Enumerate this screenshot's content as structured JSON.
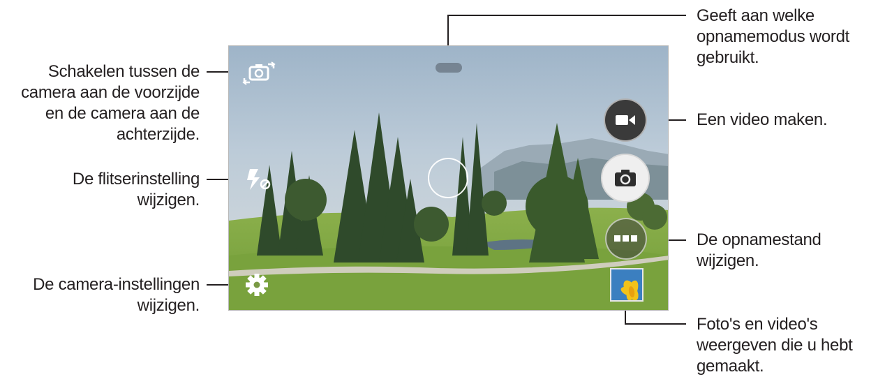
{
  "callouts": {
    "switch_camera": "Schakelen tussen de\ncamera aan de voorzijde\nen de camera aan de\nachterzijde.",
    "flash": "De flitserinstelling\nwijzigen.",
    "settings": "De camera-instellingen\nwijzigen.",
    "mode_indicator": "Geeft aan welke\nopnamemodus wordt\ngebruikt.",
    "record_video": "Een video maken.",
    "shooting_mode": "De opnamestand\nwijzigen.",
    "gallery": "Foto's en video's\nweergeven die u hebt\ngemaakt."
  },
  "icons": {
    "switch_camera": "switch-camera-icon",
    "flash": "flash-off-icon",
    "settings": "gear-icon",
    "video": "video-camera-icon",
    "shutter": "camera-icon",
    "mode": "more-dots-icon",
    "gallery": "gallery-thumbnail"
  },
  "colors": {
    "text": "#231f20",
    "leader": "#231f20",
    "sky": "#a9bdd0",
    "grass": "#7fa543",
    "button_dark": "#3c3c3c",
    "button_light": "#efefef"
  }
}
